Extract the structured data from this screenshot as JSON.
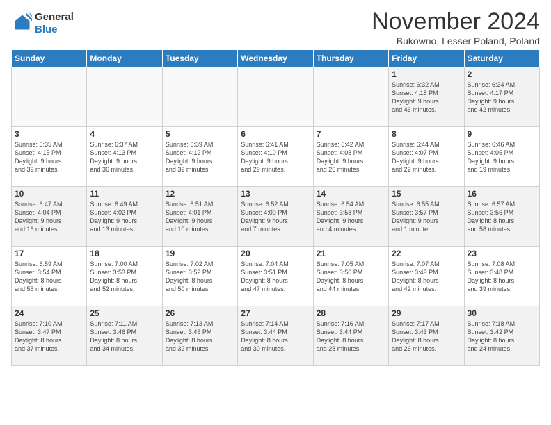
{
  "header": {
    "logo_line1": "General",
    "logo_line2": "Blue",
    "month": "November 2024",
    "location": "Bukowno, Lesser Poland, Poland"
  },
  "days_of_week": [
    "Sunday",
    "Monday",
    "Tuesday",
    "Wednesday",
    "Thursday",
    "Friday",
    "Saturday"
  ],
  "weeks": [
    [
      {
        "day": "",
        "info": ""
      },
      {
        "day": "",
        "info": ""
      },
      {
        "day": "",
        "info": ""
      },
      {
        "day": "",
        "info": ""
      },
      {
        "day": "",
        "info": ""
      },
      {
        "day": "1",
        "info": "Sunrise: 6:32 AM\nSunset: 4:18 PM\nDaylight: 9 hours\nand 46 minutes."
      },
      {
        "day": "2",
        "info": "Sunrise: 6:34 AM\nSunset: 4:17 PM\nDaylight: 9 hours\nand 42 minutes."
      }
    ],
    [
      {
        "day": "3",
        "info": "Sunrise: 6:35 AM\nSunset: 4:15 PM\nDaylight: 9 hours\nand 39 minutes."
      },
      {
        "day": "4",
        "info": "Sunrise: 6:37 AM\nSunset: 4:13 PM\nDaylight: 9 hours\nand 36 minutes."
      },
      {
        "day": "5",
        "info": "Sunrise: 6:39 AM\nSunset: 4:12 PM\nDaylight: 9 hours\nand 32 minutes."
      },
      {
        "day": "6",
        "info": "Sunrise: 6:41 AM\nSunset: 4:10 PM\nDaylight: 9 hours\nand 29 minutes."
      },
      {
        "day": "7",
        "info": "Sunrise: 6:42 AM\nSunset: 4:08 PM\nDaylight: 9 hours\nand 26 minutes."
      },
      {
        "day": "8",
        "info": "Sunrise: 6:44 AM\nSunset: 4:07 PM\nDaylight: 9 hours\nand 22 minutes."
      },
      {
        "day": "9",
        "info": "Sunrise: 6:46 AM\nSunset: 4:05 PM\nDaylight: 9 hours\nand 19 minutes."
      }
    ],
    [
      {
        "day": "10",
        "info": "Sunrise: 6:47 AM\nSunset: 4:04 PM\nDaylight: 9 hours\nand 16 minutes."
      },
      {
        "day": "11",
        "info": "Sunrise: 6:49 AM\nSunset: 4:02 PM\nDaylight: 9 hours\nand 13 minutes."
      },
      {
        "day": "12",
        "info": "Sunrise: 6:51 AM\nSunset: 4:01 PM\nDaylight: 9 hours\nand 10 minutes."
      },
      {
        "day": "13",
        "info": "Sunrise: 6:52 AM\nSunset: 4:00 PM\nDaylight: 9 hours\nand 7 minutes."
      },
      {
        "day": "14",
        "info": "Sunrise: 6:54 AM\nSunset: 3:58 PM\nDaylight: 9 hours\nand 4 minutes."
      },
      {
        "day": "15",
        "info": "Sunrise: 6:55 AM\nSunset: 3:57 PM\nDaylight: 9 hours\nand 1 minute."
      },
      {
        "day": "16",
        "info": "Sunrise: 6:57 AM\nSunset: 3:56 PM\nDaylight: 8 hours\nand 58 minutes."
      }
    ],
    [
      {
        "day": "17",
        "info": "Sunrise: 6:59 AM\nSunset: 3:54 PM\nDaylight: 8 hours\nand 55 minutes."
      },
      {
        "day": "18",
        "info": "Sunrise: 7:00 AM\nSunset: 3:53 PM\nDaylight: 8 hours\nand 52 minutes."
      },
      {
        "day": "19",
        "info": "Sunrise: 7:02 AM\nSunset: 3:52 PM\nDaylight: 8 hours\nand 50 minutes."
      },
      {
        "day": "20",
        "info": "Sunrise: 7:04 AM\nSunset: 3:51 PM\nDaylight: 8 hours\nand 47 minutes."
      },
      {
        "day": "21",
        "info": "Sunrise: 7:05 AM\nSunset: 3:50 PM\nDaylight: 8 hours\nand 44 minutes."
      },
      {
        "day": "22",
        "info": "Sunrise: 7:07 AM\nSunset: 3:49 PM\nDaylight: 8 hours\nand 42 minutes."
      },
      {
        "day": "23",
        "info": "Sunrise: 7:08 AM\nSunset: 3:48 PM\nDaylight: 8 hours\nand 39 minutes."
      }
    ],
    [
      {
        "day": "24",
        "info": "Sunrise: 7:10 AM\nSunset: 3:47 PM\nDaylight: 8 hours\nand 37 minutes."
      },
      {
        "day": "25",
        "info": "Sunrise: 7:11 AM\nSunset: 3:46 PM\nDaylight: 8 hours\nand 34 minutes."
      },
      {
        "day": "26",
        "info": "Sunrise: 7:13 AM\nSunset: 3:45 PM\nDaylight: 8 hours\nand 32 minutes."
      },
      {
        "day": "27",
        "info": "Sunrise: 7:14 AM\nSunset: 3:44 PM\nDaylight: 8 hours\nand 30 minutes."
      },
      {
        "day": "28",
        "info": "Sunrise: 7:16 AM\nSunset: 3:44 PM\nDaylight: 8 hours\nand 28 minutes."
      },
      {
        "day": "29",
        "info": "Sunrise: 7:17 AM\nSunset: 3:43 PM\nDaylight: 8 hours\nand 26 minutes."
      },
      {
        "day": "30",
        "info": "Sunrise: 7:18 AM\nSunset: 3:42 PM\nDaylight: 8 hours\nand 24 minutes."
      }
    ]
  ]
}
